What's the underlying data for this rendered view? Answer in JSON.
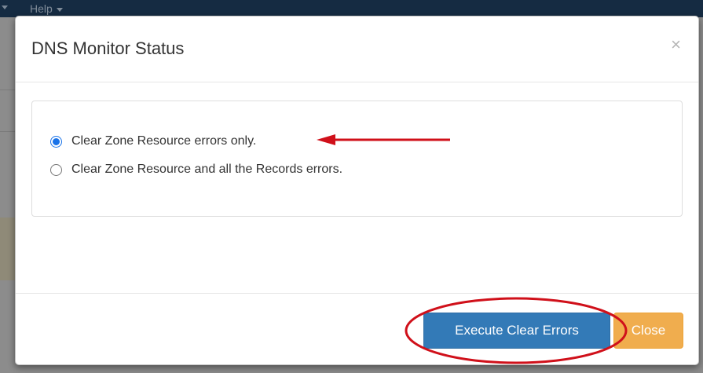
{
  "background": {
    "nav_menu_item": "Help"
  },
  "modal": {
    "title": "DNS Monitor Status",
    "close_symbol": "×",
    "options": [
      {
        "label": "Clear Zone Resource errors only.",
        "checked": true
      },
      {
        "label": "Clear Zone Resource and all the Records errors.",
        "checked": false
      }
    ],
    "buttons": {
      "execute": "Execute Clear Errors",
      "close": "Close"
    }
  },
  "colors": {
    "primary_button": "#337ab7",
    "warning_button": "#f0ad4e",
    "annotation_red": "#d0101a",
    "radio_checked": "#1a73e8"
  },
  "icons": {
    "close": "close-icon",
    "arrow": "red-arrow-left-icon",
    "highlight": "red-ellipse-highlight"
  }
}
